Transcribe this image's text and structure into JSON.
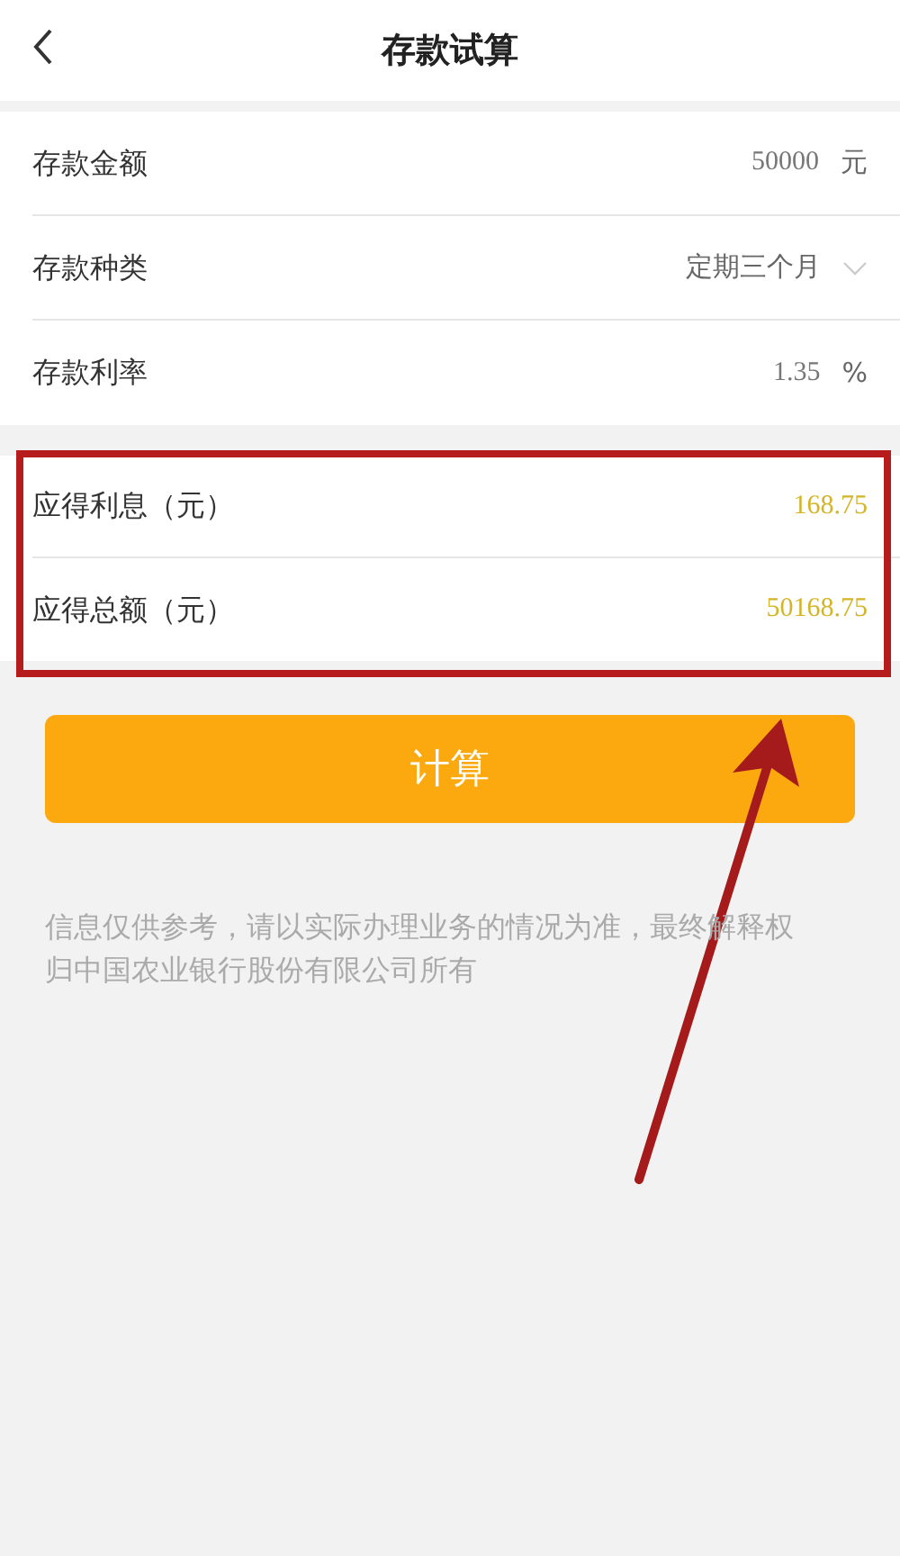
{
  "header": {
    "title": "存款试算"
  },
  "form": [
    {
      "kind": "input",
      "label": "存款金额",
      "value": "50000",
      "unit": "元"
    },
    {
      "kind": "select",
      "label": "存款种类",
      "value": "定期三个月"
    },
    {
      "kind": "input",
      "label": "存款利率",
      "value": "1.35",
      "unit": "%"
    }
  ],
  "results": [
    {
      "label": "应得利息（元）",
      "value": "168.75"
    },
    {
      "label": "应得总额（元）",
      "value": "50168.75"
    }
  ],
  "button": "计算",
  "disclaimer": "信息仅供参考，请以实际办理业务的情况为准，最终解释权归中国农业银行股份有限公司所有"
}
